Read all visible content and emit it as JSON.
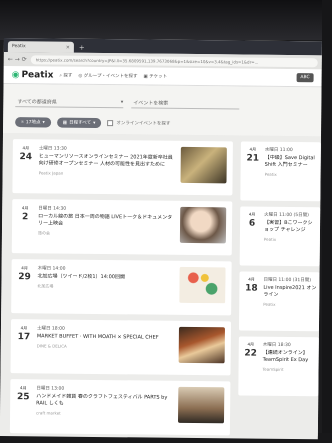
{
  "browser": {
    "tab_title": "Peatix",
    "new_tab": "+",
    "close": "×",
    "nav_arrows": "← →  ⟳",
    "url": "https://peatix.com/search?country=JP&l.ll=35.6809591,139.7673068&p=1&size=10&v=3.4&tag_ids=1&dr=..."
  },
  "site": {
    "logo_text": "Peatix",
    "nav": [
      "探す",
      "グループ・イベントを探す",
      "チケット"
    ],
    "account_btn": "ABC"
  },
  "filters": {
    "location_placeholder": "すべての都道府県",
    "category_placeholder": "イベントを検索",
    "chip_place": "17地点",
    "chip_date": "日程すべて",
    "online_label": "オンラインイベントを探す"
  },
  "events_left": [
    {
      "month": "4月",
      "day": "24",
      "time": "土曜日 13:30",
      "title": "ヒューマンリソースオンラインセミナー 2021年度新卒社員向け研修オープンセミナー 人材の可能性を見出すために",
      "org": "Peatix Japan"
    },
    {
      "month": "4月",
      "day": "2",
      "time": "日曜日 14:30",
      "title": "ローカル線の旅 日本一周の物語 LIVEトーク＆ドキュメンタリー上映会",
      "org": "旅の会"
    },
    {
      "month": "4月",
      "day": "29",
      "time": "木曜日 14:00",
      "title": "北加広場（ツイード/2枚1）14:00回開",
      "org": "北加広場"
    },
    {
      "month": "4月",
      "day": "17",
      "time": "土曜日 18:00",
      "title": "MARKET BUFFET · WITH MOATH × SPECIAL CHEF",
      "org": "DINE & DELICA"
    },
    {
      "month": "4月",
      "day": "25",
      "time": "日曜日 13:00",
      "title": "ハンドメイド雑貨 春のクラフトフェスティバル PARTS by RAIL しくも",
      "org": "craft market"
    }
  ],
  "events_right": [
    {
      "month": "4月",
      "day": "21",
      "time": "水曜日 11:00",
      "title": "【中級】Save Digital Shift 入門セミナー",
      "org": "Peatix"
    },
    {
      "month": "4月",
      "day": "6",
      "time": "火曜日 11:00 (5日間)",
      "title": "【実習】Bこワークショップ チャレンジ",
      "org": "Peatix"
    },
    {
      "month": "4月",
      "day": "18",
      "time": "日曜日 11:00 (31日間)",
      "title": "Live Inspire2021 オンライン",
      "org": "Peatix"
    },
    {
      "month": "4月",
      "day": "22",
      "time": "木曜日 18:30",
      "title": "【連続オンライン】TeamSpirit Ex Day",
      "org": "TeamSpirit"
    }
  ],
  "colors": {
    "accent": "#2bb673",
    "chip": "#6c6f78",
    "page_bg": "#ececea"
  }
}
